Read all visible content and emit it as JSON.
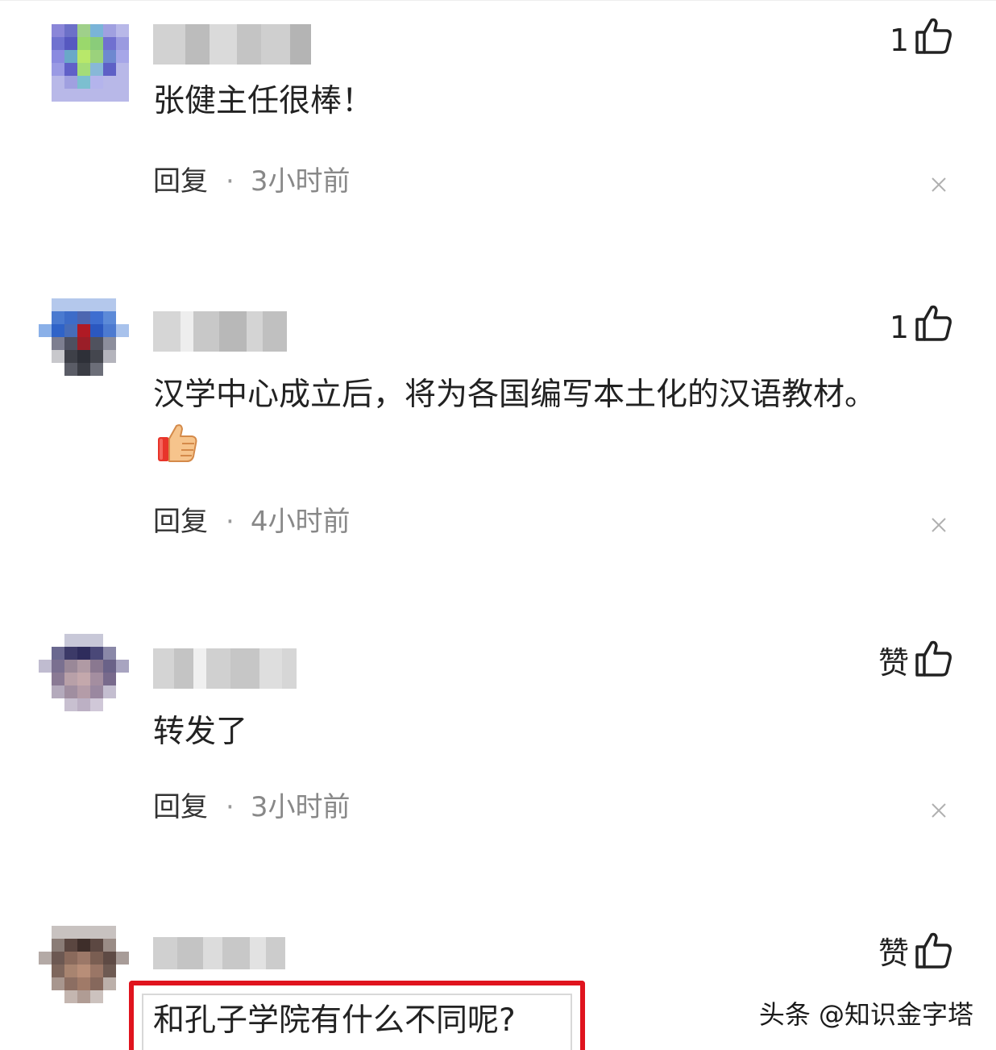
{
  "comments": [
    {
      "likes": "1",
      "text": "张健主任很棒！",
      "reply_label": "回复",
      "separator": "·",
      "time": "3小时前"
    },
    {
      "likes": "1",
      "text": "汉学中心成立后，将为各国编写本土化的汉语教材。",
      "reply_label": "回复",
      "separator": "·",
      "time": "4小时前"
    },
    {
      "likes": "赞",
      "text": "转发了",
      "reply_label": "回复",
      "separator": "·",
      "time": "3小时前"
    },
    {
      "likes": "赞",
      "text": "和孔子学院有什么不同呢?"
    }
  ],
  "watermark": "头条 @知识金字塔",
  "colors": {
    "highlight": "#e0141e",
    "time_text": "#888888"
  },
  "icons": [
    "thumbs-up-icon",
    "close-icon",
    "thumbs-up-emoji"
  ]
}
